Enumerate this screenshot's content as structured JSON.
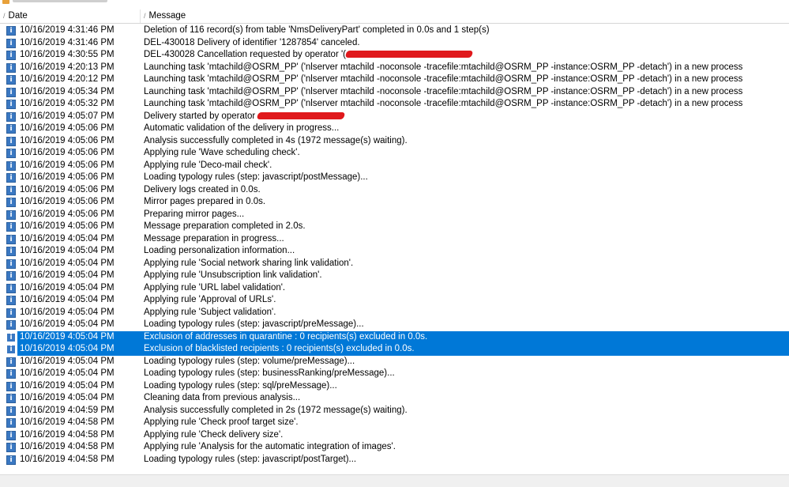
{
  "columns": {
    "date": "Date",
    "message": "Message"
  },
  "rows": [
    {
      "date": "10/16/2019 4:31:46 PM",
      "message": "Deletion of 116 record(s) from table 'NmsDeliveryPart' completed in 0.0s and 1 step(s)"
    },
    {
      "date": "10/16/2019 4:31:46 PM",
      "message": "DEL-430018 Delivery of identifier '1287854' canceled."
    },
    {
      "date": "10/16/2019 4:30:55 PM",
      "message": "DEL-430028 Cancellation requested by operator '("
    },
    {
      "date": "10/16/2019 4:20:13 PM",
      "message": "Launching task 'mtachild@OSRM_PP' ('nlserver mtachild -noconsole -tracefile:mtachild@OSRM_PP -instance:OSRM_PP -detach') in a new process"
    },
    {
      "date": "10/16/2019 4:20:12 PM",
      "message": "Launching task 'mtachild@OSRM_PP' ('nlserver mtachild -noconsole -tracefile:mtachild@OSRM_PP -instance:OSRM_PP -detach') in a new process"
    },
    {
      "date": "10/16/2019 4:05:34 PM",
      "message": "Launching task 'mtachild@OSRM_PP' ('nlserver mtachild -noconsole -tracefile:mtachild@OSRM_PP -instance:OSRM_PP -detach') in a new process"
    },
    {
      "date": "10/16/2019 4:05:32 PM",
      "message": "Launching task 'mtachild@OSRM_PP' ('nlserver mtachild -noconsole -tracefile:mtachild@OSRM_PP -instance:OSRM_PP -detach') in a new process"
    },
    {
      "date": "10/16/2019 4:05:07 PM",
      "message": "Delivery started by operator "
    },
    {
      "date": "10/16/2019 4:05:06 PM",
      "message": "Automatic validation of the delivery in progress..."
    },
    {
      "date": "10/16/2019 4:05:06 PM",
      "message": "Analysis successfully completed in 4s (1972 message(s) waiting)."
    },
    {
      "date": "10/16/2019 4:05:06 PM",
      "message": "Applying rule 'Wave scheduling check'."
    },
    {
      "date": "10/16/2019 4:05:06 PM",
      "message": "Applying rule 'Deco-mail check'."
    },
    {
      "date": "10/16/2019 4:05:06 PM",
      "message": "Loading typology rules (step: javascript/postMessage)..."
    },
    {
      "date": "10/16/2019 4:05:06 PM",
      "message": "Delivery logs created in 0.0s."
    },
    {
      "date": "10/16/2019 4:05:06 PM",
      "message": "Mirror pages prepared in 0.0s."
    },
    {
      "date": "10/16/2019 4:05:06 PM",
      "message": "Preparing mirror pages..."
    },
    {
      "date": "10/16/2019 4:05:06 PM",
      "message": "Message preparation completed in 2.0s."
    },
    {
      "date": "10/16/2019 4:05:04 PM",
      "message": "Message preparation in progress..."
    },
    {
      "date": "10/16/2019 4:05:04 PM",
      "message": "Loading personalization information..."
    },
    {
      "date": "10/16/2019 4:05:04 PM",
      "message": "Applying rule 'Social network sharing link validation'."
    },
    {
      "date": "10/16/2019 4:05:04 PM",
      "message": "Applying rule 'Unsubscription link validation'."
    },
    {
      "date": "10/16/2019 4:05:04 PM",
      "message": "Applying rule 'URL label validation'."
    },
    {
      "date": "10/16/2019 4:05:04 PM",
      "message": "Applying rule 'Approval of URLs'."
    },
    {
      "date": "10/16/2019 4:05:04 PM",
      "message": "Applying rule 'Subject validation'."
    },
    {
      "date": "10/16/2019 4:05:04 PM",
      "message": "Loading typology rules (step: javascript/preMessage)..."
    },
    {
      "date": "10/16/2019 4:05:04 PM",
      "message": "Exclusion of addresses in quarantine : 0 recipients(s) excluded in 0.0s."
    },
    {
      "date": "10/16/2019 4:05:04 PM",
      "message": "Exclusion of blacklisted recipients : 0 recipients(s) excluded in 0.0s."
    },
    {
      "date": "10/16/2019 4:05:04 PM",
      "message": "Loading typology rules (step: volume/preMessage)..."
    },
    {
      "date": "10/16/2019 4:05:04 PM",
      "message": "Loading typology rules (step: businessRanking/preMessage)..."
    },
    {
      "date": "10/16/2019 4:05:04 PM",
      "message": "Loading typology rules (step: sql/preMessage)..."
    },
    {
      "date": "10/16/2019 4:05:04 PM",
      "message": "Cleaning data from previous analysis..."
    },
    {
      "date": "10/16/2019 4:04:59 PM",
      "message": "Analysis successfully completed in 2s (1972 message(s) waiting)."
    },
    {
      "date": "10/16/2019 4:04:58 PM",
      "message": "Applying rule 'Check proof target size'."
    },
    {
      "date": "10/16/2019 4:04:58 PM",
      "message": "Applying rule 'Check delivery size'."
    },
    {
      "date": "10/16/2019 4:04:58 PM",
      "message": "Applying rule 'Analysis for the automatic integration of images'."
    },
    {
      "date": "10/16/2019 4:04:58 PM",
      "message": "Loading typology rules (step: javascript/postTarget)..."
    }
  ],
  "icons": {
    "info": "i"
  },
  "colors": {
    "selection": "#0078d7",
    "info_icon": "#3a78c2",
    "redaction": "#e0191c"
  }
}
